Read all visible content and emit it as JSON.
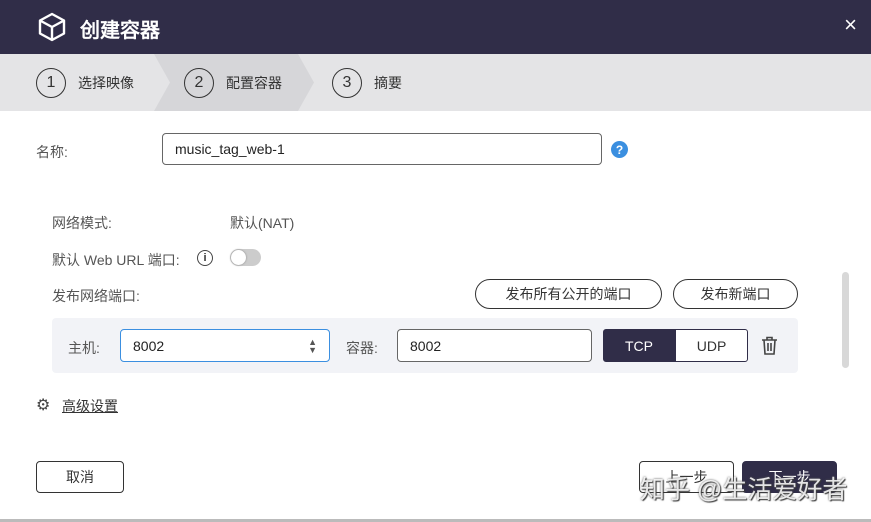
{
  "dialog": {
    "title": "创建容器",
    "close": "×"
  },
  "steps": [
    {
      "num": "1",
      "label": "选择映像"
    },
    {
      "num": "2",
      "label": "配置容器"
    },
    {
      "num": "3",
      "label": "摘要"
    }
  ],
  "form": {
    "name_label": "名称:",
    "name_value": "music_tag_web-1",
    "help": "?",
    "network_mode_label": "网络模式:",
    "network_mode_value": "默认(NAT)",
    "web_url_label": "默认 Web URL 端口:",
    "info": "i",
    "publish_label": "发布网络端口:",
    "publish_all": "发布所有公开的端口",
    "publish_new": "发布新端口",
    "host_label": "主机:",
    "host_value": "8002",
    "container_label": "容器:",
    "container_value": "8002",
    "tcp": "TCP",
    "udp": "UDP",
    "advanced": "高级设置"
  },
  "footer": {
    "cancel": "取消",
    "prev": "上一步",
    "next": "下一步"
  },
  "watermark": "知乎 @生活爱好者"
}
